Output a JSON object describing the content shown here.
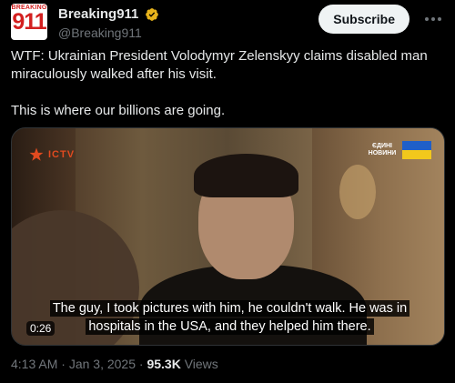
{
  "author": {
    "display_name": "Breaking911",
    "handle": "@Breaking911",
    "avatar_text_top": "BREAKING",
    "avatar_text_num": "911",
    "verified_color": "#e8b41c"
  },
  "actions": {
    "subscribe_label": "Subscribe",
    "more_icon": "ellipsis-icon"
  },
  "tweet": {
    "paragraphs": [
      "WTF: Ukrainian President Volodymyr Zelenskyy claims disabled man miraculously walked after his visit.",
      "This is where our billions are going."
    ]
  },
  "video": {
    "channel_logo": "ICTV",
    "channel_tag": "ЄДИНІ НОВИНИ",
    "caption": "The guy, I took pictures with him, he couldn't walk. He was in hospitals in the USA, and they helped him there.",
    "time_badge": "0:26"
  },
  "meta": {
    "time": "4:13 AM",
    "separator": " · ",
    "date": "Jan 3, 2025",
    "views_count": "95.3K",
    "views_label": "Views"
  }
}
